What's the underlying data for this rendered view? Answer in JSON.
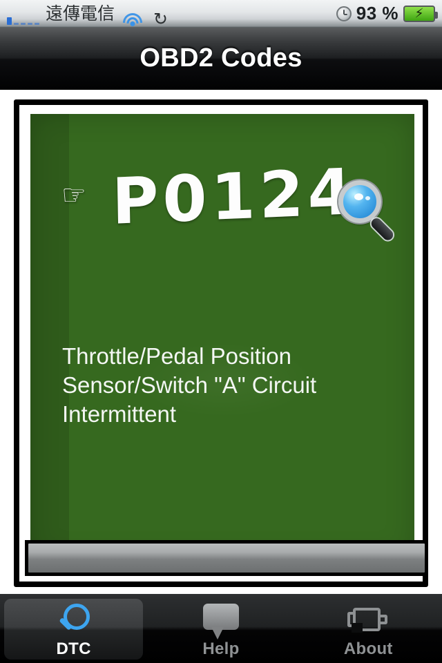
{
  "status_bar": {
    "carrier": "遠傳電信",
    "signal_bars_filled": 1,
    "signal_bars_total": 5,
    "wifi_icon": "wifi-icon",
    "sync_icon": "↻",
    "clock_icon": "clock-icon",
    "battery_percent": "93 %",
    "battery_icon": "battery-charging-icon",
    "battery_bolt": "⚡",
    "battery_color": "#4fb319"
  },
  "nav_bar": {
    "title": "OBD2 Codes"
  },
  "board": {
    "hand_icon": "☞",
    "code": "P0124",
    "magnifier_icon": "magnifier-icon",
    "description": "Throttle/Pedal Position Sensor/Switch \"A\" Circuit Intermittent",
    "board_color": "#36691f",
    "chalk_color": "#fdfdfd"
  },
  "tab_bar": {
    "active_index": 0,
    "accent_color": "#3da5f0",
    "tabs": [
      {
        "label": "DTC",
        "icon": "search-icon"
      },
      {
        "label": "Help",
        "icon": "speech-bubble-icon"
      },
      {
        "label": "About",
        "icon": "check-engine-icon"
      }
    ]
  }
}
